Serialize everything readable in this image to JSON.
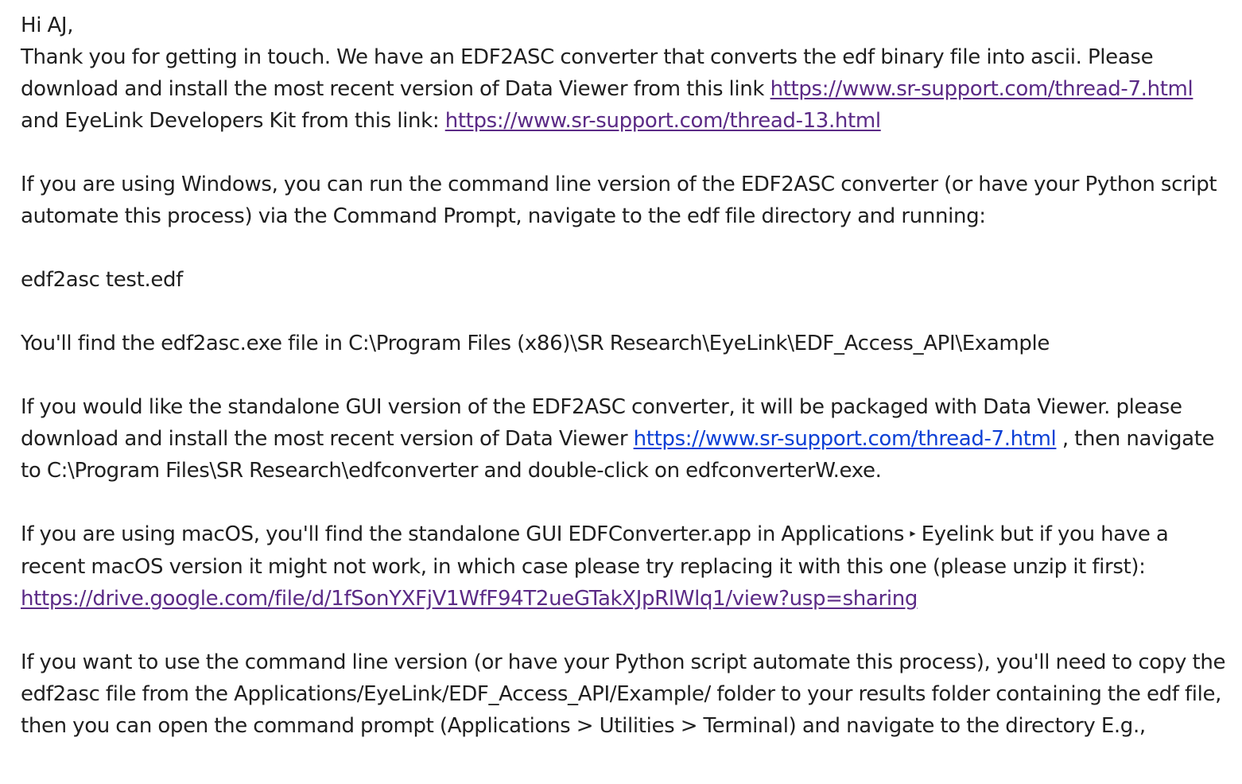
{
  "email": {
    "greeting": "Hi AJ,",
    "p1": {
      "t1": "Thank you for getting in touch. We have an EDF2ASC converter that converts the edf binary file into ascii. Please download and install the most recent version of Data Viewer from this link ",
      "link1": "https://www.sr-support.com/thread-7.html",
      "t2": " and EyeLink Developers Kit from this link: ",
      "link2": "https://www.sr-support.com/thread-13.html"
    },
    "p2": "If you are using Windows, you can run the command line version of the EDF2ASC converter (or have your Python script automate this process) via the Command Prompt, navigate to the edf file directory and running:",
    "p3": "edf2asc test.edf",
    "p4": "You'll find the edf2asc.exe file in C:\\Program Files (x86)\\SR Research\\EyeLink\\EDF_Access_API\\Example",
    "p5": {
      "t1": "If you would like the standalone GUI version of the EDF2ASC converter, it will be packaged with Data Viewer. please download and install the most recent version of Data Viewer ",
      "link": "https://www.sr-support.com/thread-7.html",
      "t2": " , then navigate to C:\\Program Files\\SR Research\\edfconverter and double-click on edfconverterW.exe."
    },
    "p6": {
      "t1": "If you are using macOS, you'll find the standalone GUI EDFConverter.app in Applications ",
      "arrow": "▸",
      "t2": " Eyelink but if you have a recent macOS version it might not work, in which case please try replacing it with this one (please unzip it first): ",
      "link": "https://drive.google.com/file/d/1fSonYXFjV1WfF94T2ueGTakXJpRlWlq1/view?usp=sharing"
    },
    "p7": "If you want to use the command line version (or have your Python script automate this process), you'll need to copy the edf2asc file from the Applications/EyeLink/EDF_Access_API/Example/ folder to your results folder containing the edf file, then you can open the command prompt (Applications > Utilities > Terminal) and navigate to the directory E.g.,"
  },
  "colors": {
    "text": "#1f1f1f",
    "visited_link": "#5b2a86",
    "link": "#0b3fd6"
  }
}
